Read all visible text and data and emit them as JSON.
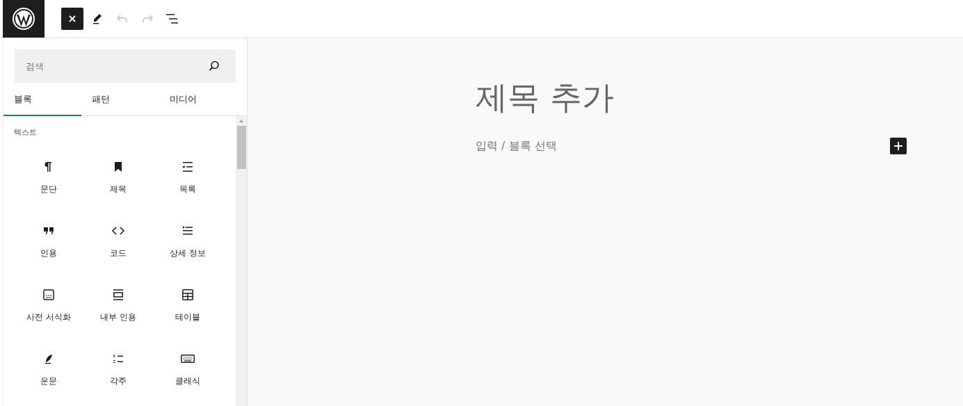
{
  "toolbar": [
    {
      "kind": "close",
      "pressed": true,
      "disabled": false
    },
    {
      "kind": "edit",
      "pressed": false,
      "disabled": false
    },
    {
      "kind": "undo",
      "pressed": false,
      "disabled": true
    },
    {
      "kind": "redo",
      "pressed": false,
      "disabled": true
    },
    {
      "kind": "outline",
      "pressed": false,
      "disabled": false
    }
  ],
  "inserter": {
    "search": {
      "placeholder": "검색"
    },
    "tabs": [
      {
        "label": "블록",
        "selected": true
      },
      {
        "label": "패턴",
        "selected": false
      },
      {
        "label": "미디어",
        "selected": false
      }
    ],
    "category": "텍스트",
    "blocks": [
      {
        "label": "문단"
      },
      {
        "label": "제목"
      },
      {
        "label": "목록"
      },
      {
        "label": "인용"
      },
      {
        "label": "코드"
      },
      {
        "label": "상세 정보"
      },
      {
        "label": "사전 서식화"
      },
      {
        "label": "내부 인용"
      },
      {
        "label": "테이블"
      },
      {
        "label": "운문"
      },
      {
        "label": "각주"
      },
      {
        "label": "클래식"
      }
    ]
  },
  "editor": {
    "title_placeholder": "제목 추가",
    "block_placeholder": "입력 / 블록 선택"
  }
}
